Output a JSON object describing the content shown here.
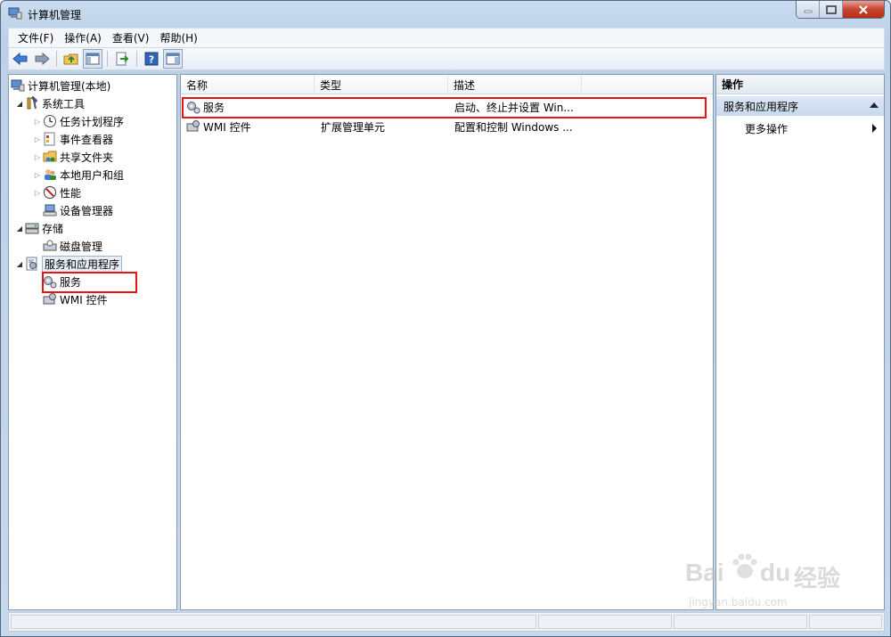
{
  "window": {
    "title": "计算机管理"
  },
  "menu": [
    "文件(F)",
    "操作(A)",
    "查看(V)",
    "帮助(H)"
  ],
  "toolbar": {
    "icons": [
      "back-icon",
      "forward-icon",
      "up-folder-icon",
      "show-hide-tree-icon",
      "export-list-icon",
      "help-icon",
      "show-hide-action-pane-icon"
    ]
  },
  "tree": {
    "root": "计算机管理(本地)",
    "items": [
      {
        "label": "系统工具"
      },
      {
        "label": "任务计划程序"
      },
      {
        "label": "事件查看器"
      },
      {
        "label": "共享文件夹"
      },
      {
        "label": "本地用户和组"
      },
      {
        "label": "性能"
      },
      {
        "label": "设备管理器"
      },
      {
        "label": "存储"
      },
      {
        "label": "磁盘管理"
      },
      {
        "label": "服务和应用程序"
      },
      {
        "label": "服务"
      },
      {
        "label": "WMI 控件"
      }
    ]
  },
  "list": {
    "columns": [
      "名称",
      "类型",
      "描述"
    ],
    "rows": [
      {
        "name": "服务",
        "type": "",
        "desc": "启动、终止并设置 Win..."
      },
      {
        "name": "WMI 控件",
        "type": "扩展管理单元",
        "desc": "配置和控制 Windows ..."
      }
    ]
  },
  "actions": {
    "header": "操作",
    "group": "服务和应用程序",
    "more": "更多操作"
  },
  "watermark": {
    "brand": "Bai",
    "du": "du",
    "jingyan": "经验",
    "url": "jingyan.baidu.com"
  },
  "colors": {
    "highlight_box": "#e11111",
    "selection_bg": "#c8d9ee"
  }
}
